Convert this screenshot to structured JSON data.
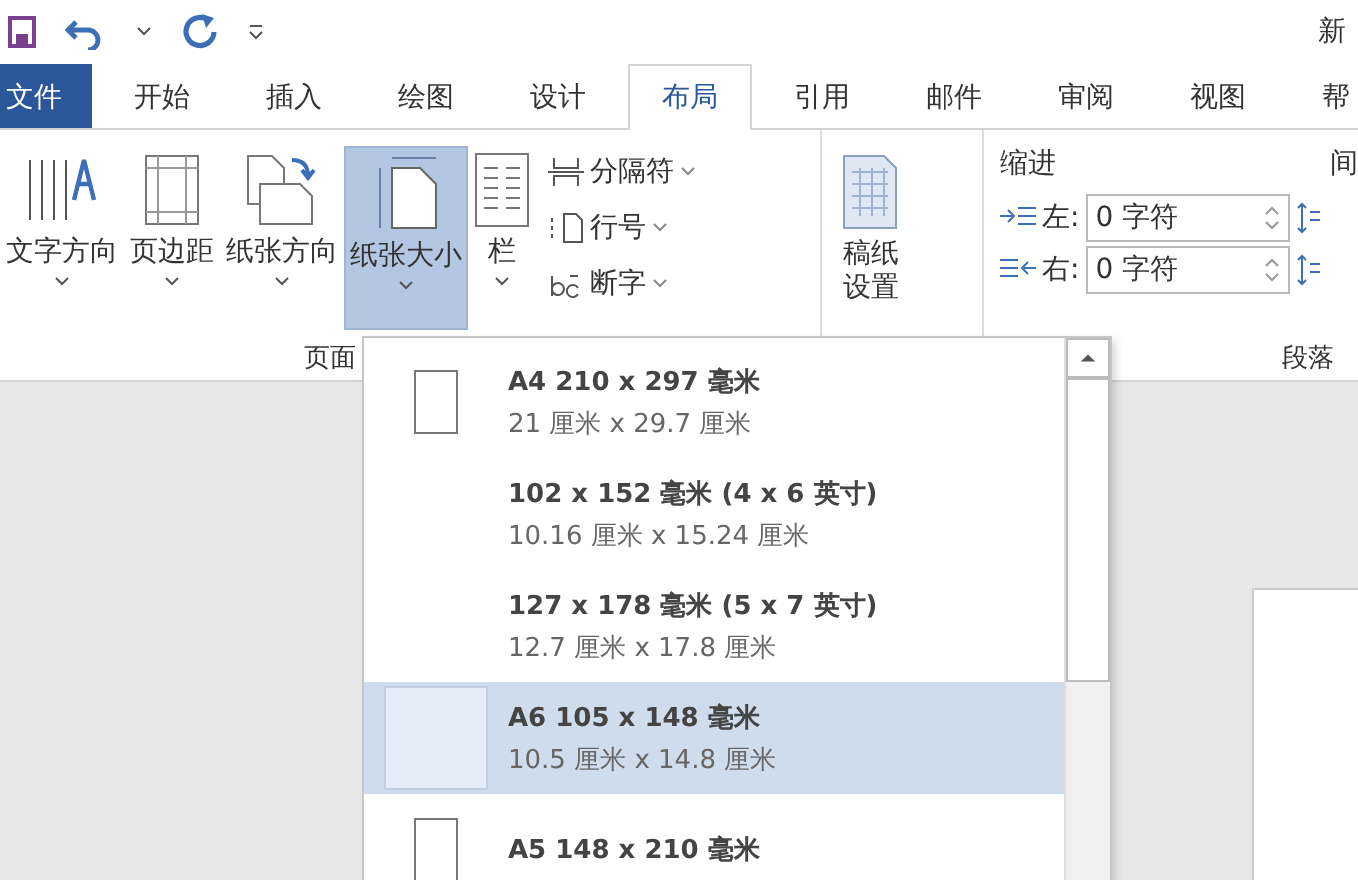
{
  "window": {
    "title": "新"
  },
  "tabs": [
    {
      "label": "文件",
      "kind": "file",
      "selected": false
    },
    {
      "label": "开始",
      "kind": "tab",
      "selected": false
    },
    {
      "label": "插入",
      "kind": "tab",
      "selected": false
    },
    {
      "label": "绘图",
      "kind": "tab",
      "selected": false
    },
    {
      "label": "设计",
      "kind": "tab",
      "selected": false
    },
    {
      "label": "布局",
      "kind": "tab",
      "selected": true
    },
    {
      "label": "引用",
      "kind": "tab",
      "selected": false
    },
    {
      "label": "邮件",
      "kind": "tab",
      "selected": false
    },
    {
      "label": "审阅",
      "kind": "tab",
      "selected": false
    },
    {
      "label": "视图",
      "kind": "tab",
      "selected": false
    },
    {
      "label": "帮",
      "kind": "tab",
      "selected": false
    }
  ],
  "page_setup": {
    "label": "页面",
    "buttons": [
      {
        "label": "文字方向",
        "kind": "text-direction",
        "selected": false
      },
      {
        "label": "页边距",
        "kind": "margins",
        "selected": false
      },
      {
        "label": "纸张方向",
        "kind": "orientation",
        "selected": false
      },
      {
        "label": "纸张大小",
        "kind": "size",
        "selected": true
      },
      {
        "label": "栏",
        "kind": "columns",
        "selected": false
      }
    ],
    "small_buttons": [
      {
        "label": "分隔符",
        "kind": "breaks"
      },
      {
        "label": "行号",
        "kind": "line-numbers"
      },
      {
        "label": "断字",
        "kind": "hyphenation"
      }
    ]
  },
  "manuscript": {
    "label": "稿纸设置"
  },
  "paragraph": {
    "label": "段落",
    "indent_title": "缩进",
    "spacing_title": "间",
    "fields": [
      {
        "label": "左:",
        "value": "0 字符",
        "kind": "left"
      },
      {
        "label": "右:",
        "value": "0 字符",
        "kind": "right"
      }
    ]
  },
  "dropdown": {
    "items": [
      {
        "name": "A4 210 x 297 毫米",
        "size": "21 厘米 x 29.7 厘米",
        "kind": "icon",
        "selected": false
      },
      {
        "name": "102 x 152 毫米 (4 x 6 英寸)",
        "size": "10.16 厘米 x 15.24 厘米",
        "kind": "plain",
        "selected": false
      },
      {
        "name": "127 x 178 毫米 (5 x 7 英寸)",
        "size": "12.7 厘米 x 17.8 厘米",
        "kind": "plain",
        "selected": false
      },
      {
        "name": "A6 105 x 148 毫米",
        "size": "10.5 厘米 x 14.8 厘米",
        "kind": "icon",
        "selected": true
      },
      {
        "name": "A5 148 x 210 毫米",
        "kind": "icon",
        "selected": false
      }
    ]
  }
}
